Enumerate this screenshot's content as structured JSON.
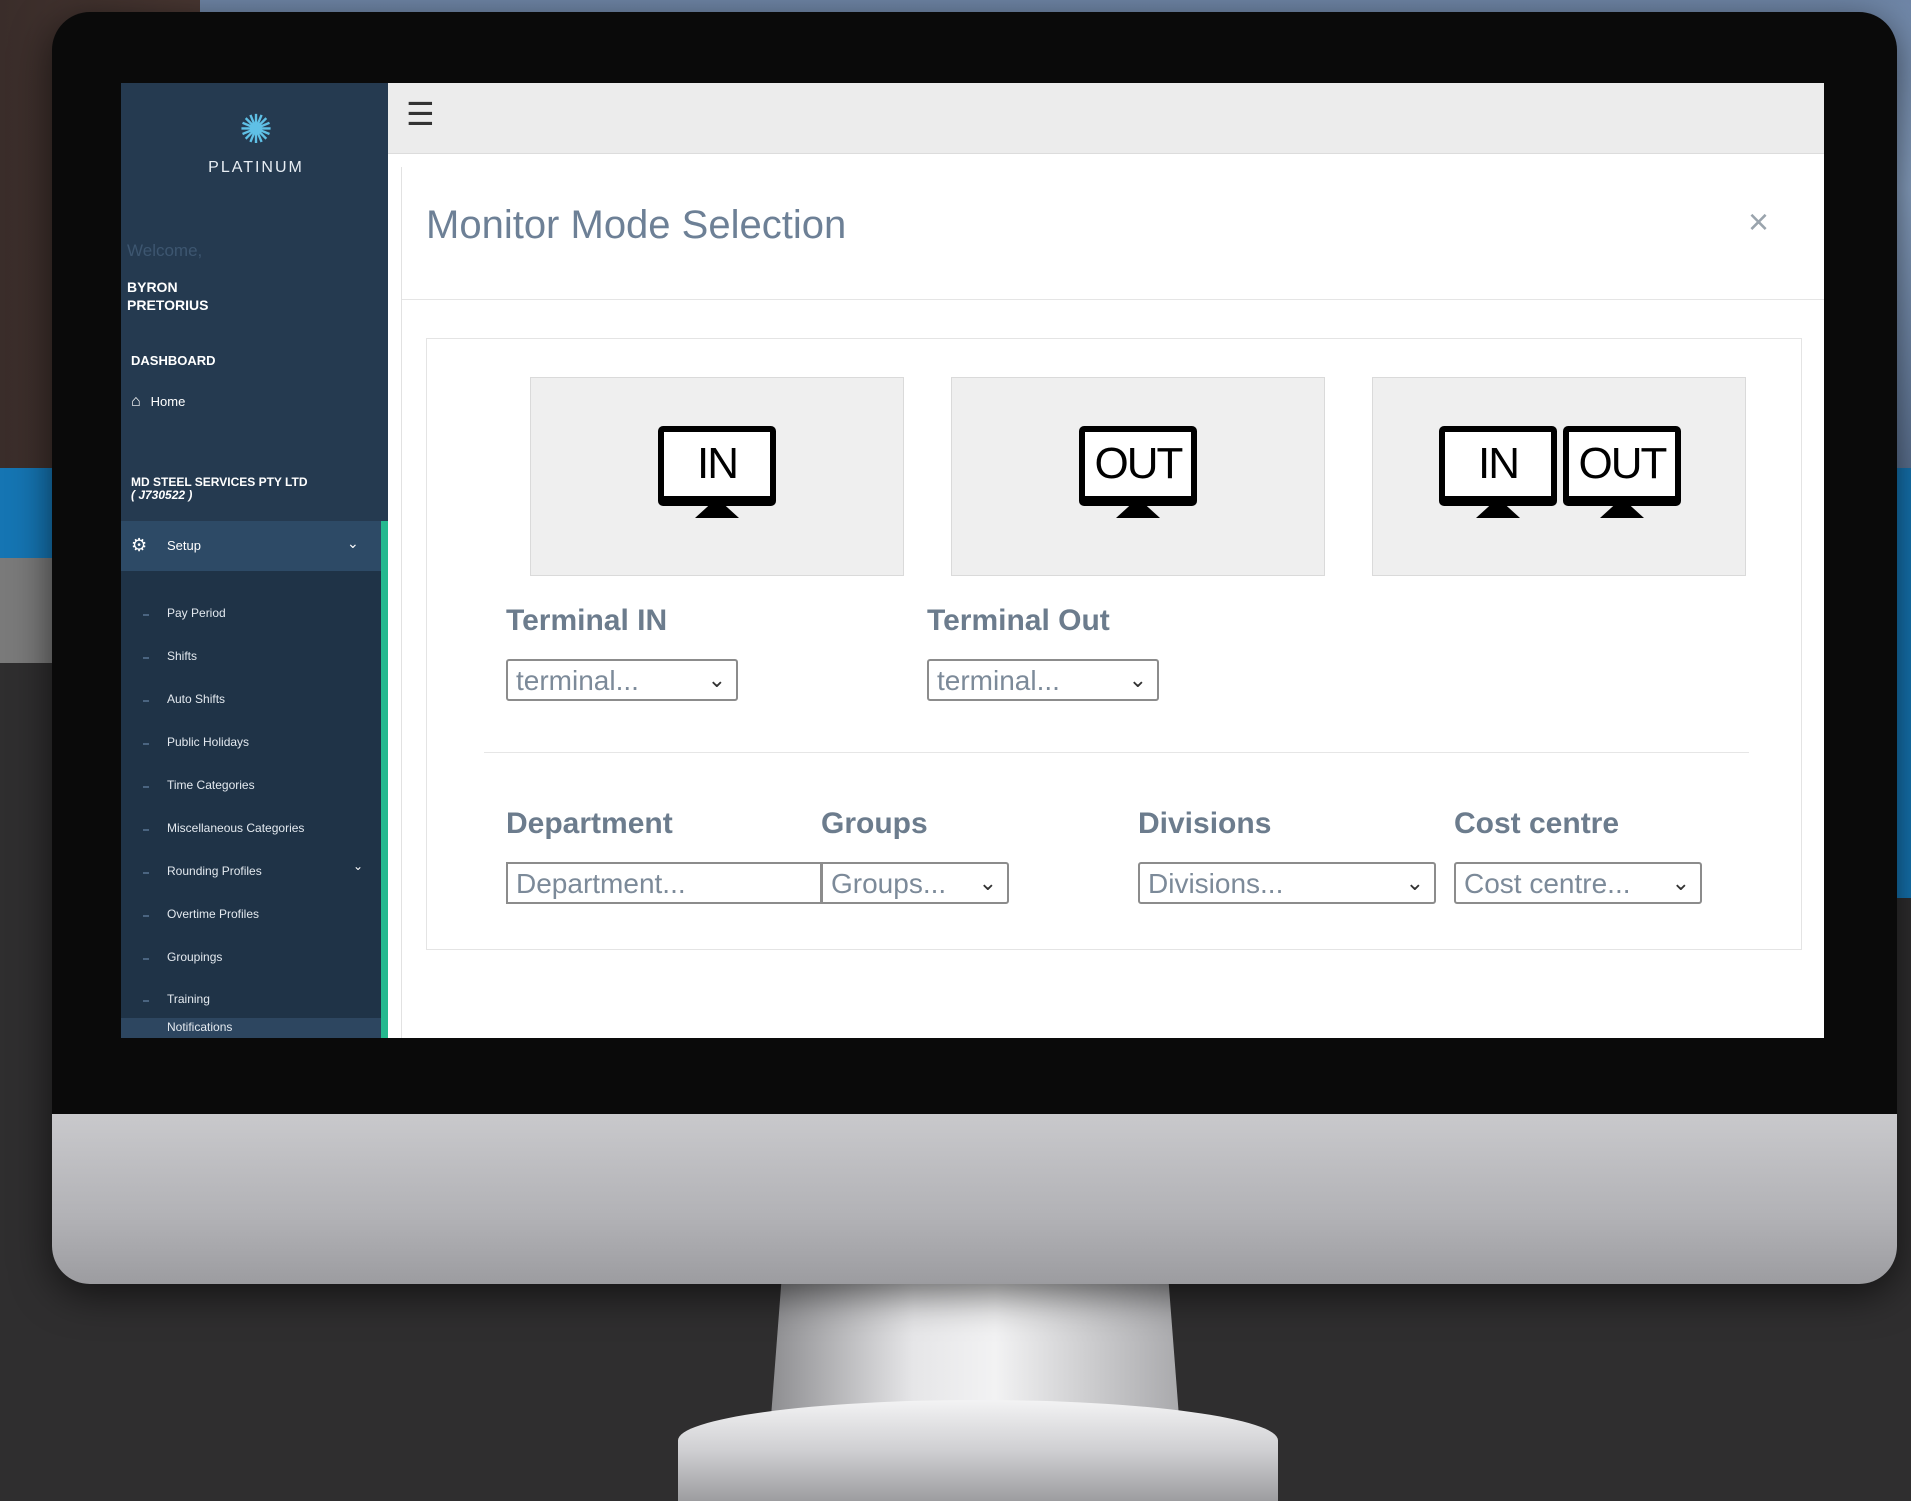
{
  "sidebar": {
    "brand": "PLATINUM",
    "welcome": "Welcome,",
    "user_first": "BYRON",
    "user_last": "PRETORIUS",
    "dashboard_label": "DASHBOARD",
    "home_label": "Home",
    "company_name": "MD STEEL SERVICES PTY LTD",
    "company_code": "( J730522 )",
    "setup_label": "Setup",
    "items": [
      {
        "label": "Pay Period"
      },
      {
        "label": "Shifts"
      },
      {
        "label": "Auto Shifts"
      },
      {
        "label": "Public Holidays"
      },
      {
        "label": "Time Categories"
      },
      {
        "label": "Miscellaneous Categories"
      },
      {
        "label": "Rounding Profiles"
      },
      {
        "label": "Overtime Profiles"
      },
      {
        "label": "Groupings"
      },
      {
        "label": "Training"
      },
      {
        "label": "Notifications"
      }
    ]
  },
  "modal": {
    "title": "Monitor Mode Selection",
    "close": "×",
    "modes": [
      {
        "screens": [
          "IN"
        ]
      },
      {
        "screens": [
          "OUT"
        ]
      },
      {
        "screens": [
          "IN",
          "OUT"
        ]
      }
    ],
    "terminal_in": {
      "label": "Terminal IN",
      "value": "terminal..."
    },
    "terminal_out": {
      "label": "Terminal Out",
      "value": "terminal..."
    },
    "department": {
      "label": "Department",
      "placeholder": "Department..."
    },
    "groups": {
      "label": "Groups",
      "value": "Groups..."
    },
    "divisions": {
      "label": "Divisions",
      "value": "Divisions..."
    },
    "cost_centre": {
      "label": "Cost centre",
      "value": "Cost centre..."
    }
  },
  "icons": {
    "menu": "hamburger-icon",
    "home": "home-icon",
    "setup": "gears-icon",
    "chevron": "chevron-down-icon",
    "close": "close-icon"
  },
  "colors": {
    "sidebar_bg": "#253a50",
    "accent": "#25b98f",
    "title_text": "#6d8096"
  }
}
